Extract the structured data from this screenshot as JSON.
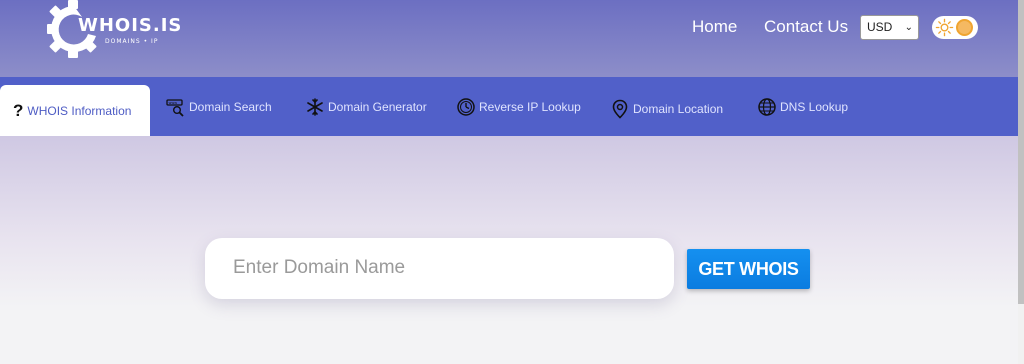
{
  "brand": {
    "name": "WHOIS.IS",
    "tagline": "DOMAINS • IP"
  },
  "header": {
    "nav": [
      {
        "label": "Home"
      },
      {
        "label": "Contact Us"
      }
    ],
    "currency": {
      "selected": "USD"
    },
    "theme_toggle": {
      "icon": "sun-icon",
      "state": "light"
    }
  },
  "tabs": [
    {
      "label": "WHOIS Information",
      "icon": "question-icon",
      "active": true
    },
    {
      "label": "Domain Search",
      "icon": "domain-search-icon"
    },
    {
      "label": "Domain Generator",
      "icon": "snowflake-icon"
    },
    {
      "label": "Reverse IP Lookup",
      "icon": "clock-icon"
    },
    {
      "label": "Domain Location",
      "icon": "location-pin-icon"
    },
    {
      "label": "DNS Lookup",
      "icon": "globe-icon"
    }
  ],
  "search": {
    "placeholder": "Enter Domain Name",
    "value": "",
    "button_label": "GET WHOIS"
  },
  "colors": {
    "header": "#7476c4",
    "tabbar": "#5160c9",
    "button": "#1088ea",
    "active_tab_text": "#4e5cc4"
  }
}
